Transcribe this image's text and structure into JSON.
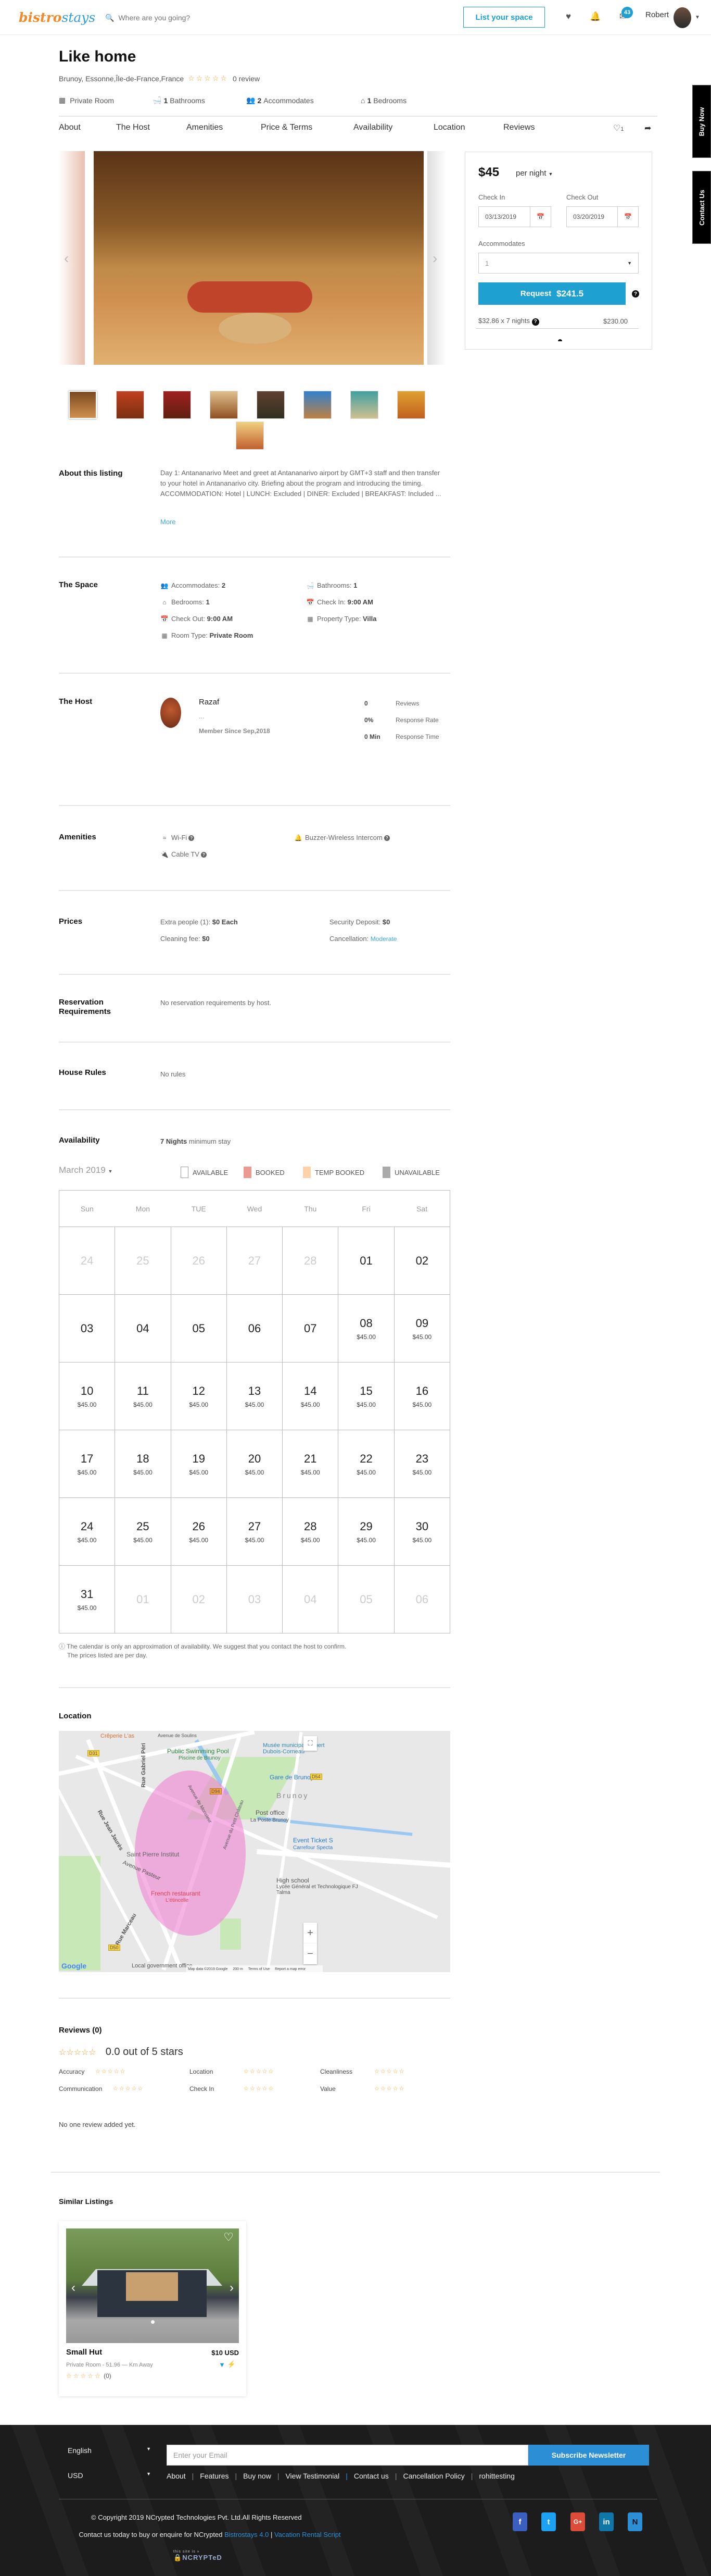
{
  "header": {
    "logo_part1": "bistro",
    "logo_part2": "stays",
    "search_placeholder": "Where are you going?",
    "list_space": "List your space",
    "messages_count": "43",
    "user_name": "Robert"
  },
  "side_tabs": {
    "buy_now": "Buy Now",
    "contact_us": "Contact Us"
  },
  "listing": {
    "title": "Like home",
    "location": "Brunoy, Essonne,Île-de-France,France",
    "rating_stars": 0,
    "review_count": "0 review",
    "facts": [
      {
        "icon": "building-icon",
        "value": "",
        "label": "Private Room"
      },
      {
        "icon": "bath-icon",
        "value": "1",
        "label": "Bathrooms"
      },
      {
        "icon": "users-icon",
        "value": "2",
        "label": "Accommodates"
      },
      {
        "icon": "home-icon",
        "value": "1",
        "label": "Bedrooms"
      }
    ]
  },
  "tabs": [
    "About",
    "The Host",
    "Amenities",
    "Price & Terms",
    "Availability",
    "Location",
    "Reviews"
  ],
  "wishlist_count": "1",
  "booking": {
    "price": "$45",
    "period": "per night",
    "check_in_label": "Check In",
    "check_in_value": "03/13/2019",
    "check_out_label": "Check Out",
    "check_out_value": "03/20/2019",
    "accommodates_label": "Accommodates",
    "accommodates_value": "1",
    "request_label": "Request",
    "request_amount": "$241.5",
    "breakdown_label": "$32.86 x 7 nights",
    "breakdown_value": "$230.00"
  },
  "gallery": {
    "thumb_count": 9,
    "active_index": 0
  },
  "about": {
    "heading": "About this listing",
    "text": "Day 1: Antananarivo Meet and greet at Antananarivo airport by GMT+3 staff and then transfer to your hotel in Antananarivo city. Briefing about the program and introducing the timing. ACCOMMODATION: Hotel | LUNCH: Excluded | DINER: Excluded | BREAKFAST: Included ...",
    "more": "More"
  },
  "space": {
    "heading": "The Space",
    "items": [
      {
        "icon": "users-icon",
        "label": "Accommodates:",
        "value": "2"
      },
      {
        "icon": "bath-icon",
        "label": "Bathrooms:",
        "value": "1"
      },
      {
        "icon": "home-icon",
        "label": "Bedrooms:",
        "value": "1"
      },
      {
        "icon": "calendar-icon",
        "label": "Check In:",
        "value": "9:00 AM"
      },
      {
        "icon": "calendar-icon",
        "label": "Check Out:",
        "value": "9:00 AM"
      },
      {
        "icon": "building-icon",
        "label": "Property Type:",
        "value": "Villa"
      },
      {
        "icon": "building-icon",
        "label": "Room Type:",
        "value": "Private Room"
      }
    ]
  },
  "host": {
    "heading": "The Host",
    "name": "Razaf",
    "bio": "...",
    "member_since": "Member Since Sep,2018",
    "stats": [
      {
        "value": "0",
        "label": "Reviews"
      },
      {
        "value": "0%",
        "label": "Response Rate"
      },
      {
        "value": "0 Min",
        "label": "Response Time"
      }
    ]
  },
  "amenities": {
    "heading": "Amenities",
    "items": [
      {
        "icon": "wifi-icon",
        "label": "Wi-Fi"
      },
      {
        "icon": "bell-icon",
        "label": "Buzzer-Wireless Intercom"
      },
      {
        "icon": "plug-icon",
        "label": "Cable TV"
      }
    ]
  },
  "prices": {
    "heading": "Prices",
    "extra_people_label": "Extra people (1):",
    "extra_people_value": "$0 Each",
    "cleaning_label": "Cleaning fee:",
    "cleaning_value": "$0",
    "deposit_label": "Security Deposit:",
    "deposit_value": "$0",
    "cancellation_label": "Cancellation:",
    "cancellation_value": "Moderate"
  },
  "reservation": {
    "heading_line1": "Reservation",
    "heading_line2": "Requirements",
    "text": "No reservation requirements by host."
  },
  "house_rules": {
    "heading": "House Rules",
    "text": "No rules"
  },
  "availability": {
    "heading": "Availability",
    "min_stay_value": "7 Nights",
    "min_stay_text": "minimum stay",
    "month": "March 2019",
    "legend": [
      {
        "label": "AVAILABLE",
        "color": "#ffffff"
      },
      {
        "label": "BOOKED",
        "color": "#ec9a90"
      },
      {
        "label": "TEMP BOOKED",
        "color": "#fdd2a8"
      },
      {
        "label": "UNAVAILABLE",
        "color": "#aaaaaa"
      }
    ],
    "weekdays": [
      "Sun",
      "Mon",
      "TUE",
      "Wed",
      "Thu",
      "Fri",
      "Sat"
    ],
    "weeks": [
      [
        {
          "d": "24",
          "off": true
        },
        {
          "d": "25",
          "off": true
        },
        {
          "d": "26",
          "off": true
        },
        {
          "d": "27",
          "off": true
        },
        {
          "d": "28",
          "off": true
        },
        {
          "d": "01"
        },
        {
          "d": "02"
        }
      ],
      [
        {
          "d": "03"
        },
        {
          "d": "04"
        },
        {
          "d": "05"
        },
        {
          "d": "06"
        },
        {
          "d": "07"
        },
        {
          "d": "08",
          "p": "$45.00"
        },
        {
          "d": "09",
          "p": "$45.00"
        }
      ],
      [
        {
          "d": "10",
          "p": "$45.00"
        },
        {
          "d": "11",
          "p": "$45.00"
        },
        {
          "d": "12",
          "p": "$45.00"
        },
        {
          "d": "13",
          "p": "$45.00"
        },
        {
          "d": "14",
          "p": "$45.00"
        },
        {
          "d": "15",
          "p": "$45.00"
        },
        {
          "d": "16",
          "p": "$45.00"
        }
      ],
      [
        {
          "d": "17",
          "p": "$45.00"
        },
        {
          "d": "18",
          "p": "$45.00"
        },
        {
          "d": "19",
          "p": "$45.00"
        },
        {
          "d": "20",
          "p": "$45.00"
        },
        {
          "d": "21",
          "p": "$45.00"
        },
        {
          "d": "22",
          "p": "$45.00"
        },
        {
          "d": "23",
          "p": "$45.00"
        }
      ],
      [
        {
          "d": "24",
          "p": "$45.00"
        },
        {
          "d": "25",
          "p": "$45.00"
        },
        {
          "d": "26",
          "p": "$45.00"
        },
        {
          "d": "27",
          "p": "$45.00"
        },
        {
          "d": "28",
          "p": "$45.00"
        },
        {
          "d": "29",
          "p": "$45.00"
        },
        {
          "d": "30",
          "p": "$45.00"
        }
      ],
      [
        {
          "d": "31",
          "p": "$45.00"
        },
        {
          "d": "01",
          "off": true
        },
        {
          "d": "02",
          "off": true
        },
        {
          "d": "03",
          "off": true
        },
        {
          "d": "04",
          "off": true
        },
        {
          "d": "05",
          "off": true
        },
        {
          "d": "06",
          "off": true
        }
      ]
    ],
    "note_line1": "The calendar is only an approximation of availability. We suggest that you contact the host to confirm.",
    "note_line2": "The prices listed are per day."
  },
  "location": {
    "heading": "Location",
    "map_labels": [
      "Crêperie L'as",
      "Avenue de Soulins",
      "Public Swimming Pool",
      "Piscine de Brunoy",
      "Musée municipal Robert Dubois-Corneau",
      "Gare de Brunoy",
      "Brunoy",
      "Post office",
      "La Poste Brunoy",
      "Event Ticket S",
      "Carrefour Specta",
      "Saint Pierre Institut",
      "Avenue Pasteur",
      "French restaurant",
      "L'étincelle",
      "High school",
      "Lycée Général et Technologique FJ Talma",
      "Rue Gabriel Péri",
      "Rue Jean Jaurès",
      "Avenue de Monsieur",
      "Avenue du Petit Château",
      "Rue Marceau",
      "Local government office",
      "D31",
      "D94",
      "D54",
      "D50"
    ],
    "attribution": "Map data ©2019 Google",
    "scale": "200 m",
    "terms": "Terms of Use",
    "report": "Report a map error",
    "google": "Google"
  },
  "reviews": {
    "heading": "Reviews (0)",
    "overall": "0.0 out of 5 stars",
    "overall_stars": 0,
    "categories": [
      {
        "label": "Accuracy",
        "stars": 0
      },
      {
        "label": "Location",
        "stars": 0
      },
      {
        "label": "Cleanliness",
        "stars": 0
      },
      {
        "label": "Communication",
        "stars": 0
      },
      {
        "label": "Check In",
        "stars": 0
      },
      {
        "label": "Value",
        "stars": 0
      }
    ],
    "empty": "No one review added yet."
  },
  "similar": {
    "heading": "Similar Listings",
    "cards": [
      {
        "title": "Small Hut",
        "price": "$10 USD",
        "subtitle": "Private Room - 51.96 — Km Away",
        "stars": 0,
        "review_count": "(0)"
      }
    ]
  },
  "footer": {
    "language": "English",
    "currency": "USD",
    "email_placeholder": "Enter your Email",
    "subscribe": "Subscribe Newsletter",
    "links": [
      "About",
      "Features",
      "Buy now",
      "View Testimonial",
      "Contact us",
      "Cancellation Policy",
      "rohittesting"
    ],
    "copyright": "© Copyright 2019 NCrypted Technologies Pvt. Ltd.All Rights Reserved",
    "contact_text": "Contact us today to buy or enquire for NCrypted",
    "contact_link1": "Bistrostays 4.0",
    "contact_link2": "Vacation Rental Script",
    "badge_small": "this site is »",
    "badge_text": "NCRYPTeD",
    "social": [
      {
        "name": "facebook",
        "glyph": "f",
        "color": "#3b5fc0"
      },
      {
        "name": "twitter",
        "glyph": "t",
        "color": "#1da1f2"
      },
      {
        "name": "google-plus",
        "glyph": "G+",
        "color": "#dd4b39"
      },
      {
        "name": "linkedin",
        "glyph": "in",
        "color": "#0e76a8"
      },
      {
        "name": "ncrypted",
        "glyph": "N",
        "color": "#2c8fd6"
      }
    ]
  }
}
